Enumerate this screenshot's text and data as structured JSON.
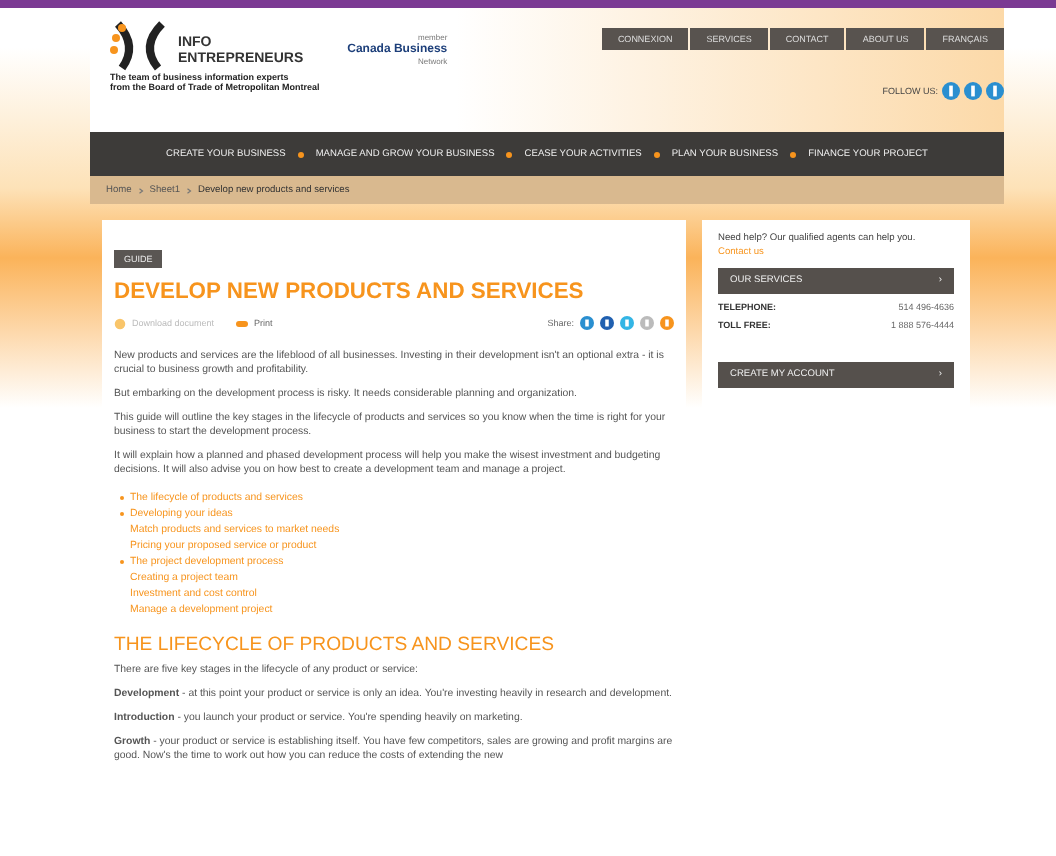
{
  "logo": {
    "line1": "INFO",
    "line2": "ENTREPRENEURS",
    "tagline1": "The team of business information experts",
    "tagline2": "from the Board of Trade of Metropolitan Montreal"
  },
  "partner": {
    "member": "member",
    "name": "Canada Business",
    "network": "Network"
  },
  "top_nav": [
    "CONNEXION",
    "SERVICES",
    "CONTACT",
    "ABOUT US",
    "FRANÇAIS"
  ],
  "follow_us": "FOLLOW US:",
  "main_nav": [
    "CREATE YOUR BUSINESS",
    "MANAGE AND GROW YOUR BUSINESS",
    "CEASE YOUR ACTIVITIES",
    "PLAN YOUR BUSINESS",
    "FINANCE YOUR PROJECT"
  ],
  "breadcrumb": [
    "Home",
    "Sheet1",
    "Develop new products and services"
  ],
  "article": {
    "tag": "GUIDE",
    "title": "DEVELOP NEW PRODUCTS AND SERVICES",
    "download": "Download document",
    "print": "Print",
    "share": "Share:",
    "intro": [
      "New products and services are the lifeblood of all businesses. Investing in their development isn't an optional extra - it is crucial to business growth and profitability.",
      "But embarking on the development process is risky. It needs considerable planning and organization.",
      "This guide will outline the key stages in the lifecycle of products and services so you know when the time is right for your business to start the development process.",
      "It will explain how a planned and phased development process will help you make the wisest investment and budgeting decisions. It will also advise you on how best to create a development team and manage a project."
    ],
    "toc": [
      {
        "label": "The lifecycle of products and services"
      },
      {
        "label": "Developing your ideas",
        "children": [
          {
            "label": "Match products and services to market needs"
          },
          {
            "label": "Pricing your proposed service or product"
          }
        ]
      },
      {
        "label": "The project development process",
        "children": [
          {
            "label": "Creating a project team"
          },
          {
            "label": "Investment and cost control"
          },
          {
            "label": "Manage a development project"
          }
        ]
      }
    ],
    "section_title": "THE LIFECYCLE OF PRODUCTS AND SERVICES",
    "section_paragraphs": [
      "There are five key stages in the lifecycle of any product or service:",
      "**Development** - at this point your product or service is only an idea. You're investing heavily in research and development.",
      "**Introduction** - you launch your product or service. You're spending heavily on marketing.",
      "**Growth** - your product or service is establishing itself. You have few competitors, sales are growing and profit margins are good. Now's the time to work out how you can reduce the costs of extending the new"
    ]
  },
  "sidebar": {
    "help": "Need help? Our qualified agents can help you.",
    "contact_link": "Contact us",
    "services_button": "OUR SERVICES",
    "phones": [
      {
        "label": "TELEPHONE:",
        "value": "514 496-4636"
      },
      {
        "label": "TOLL FREE:",
        "value": "1 888 576-4444"
      }
    ],
    "account_button": "CREATE MY ACCOUNT",
    "chevron": "›"
  }
}
